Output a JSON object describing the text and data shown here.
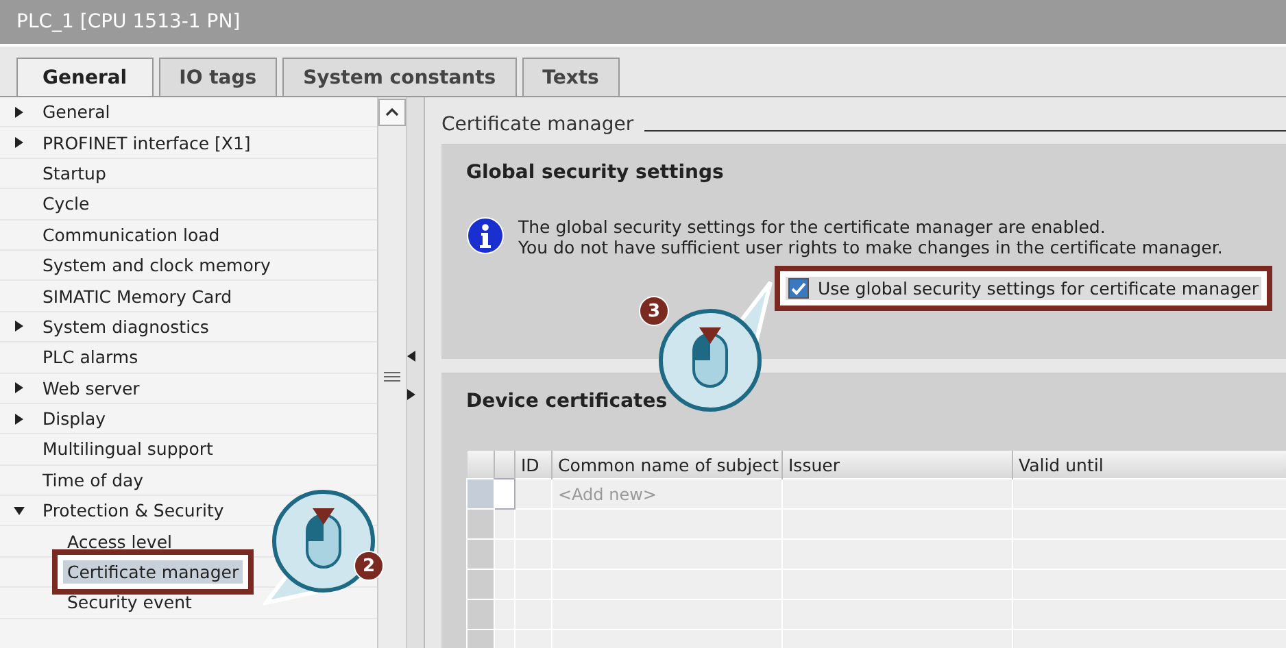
{
  "window": {
    "title": "PLC_1 [CPU 1513-1 PN]"
  },
  "tabs": [
    {
      "label": "General",
      "selected": true
    },
    {
      "label": "IO tags",
      "selected": false
    },
    {
      "label": "System constants",
      "selected": false
    },
    {
      "label": "Texts",
      "selected": false
    }
  ],
  "tree": [
    {
      "label": "General",
      "kind": "group",
      "expanded": false,
      "selected": false
    },
    {
      "label": "PROFINET interface [X1]",
      "kind": "group",
      "expanded": false,
      "selected": false
    },
    {
      "label": "Startup",
      "kind": "page",
      "selected": false
    },
    {
      "label": "Cycle",
      "kind": "page",
      "selected": false
    },
    {
      "label": "Communication load",
      "kind": "page",
      "selected": false
    },
    {
      "label": "System and clock memory",
      "kind": "page",
      "selected": false
    },
    {
      "label": "SIMATIC Memory Card",
      "kind": "page",
      "selected": false
    },
    {
      "label": "System diagnostics",
      "kind": "group",
      "expanded": false,
      "selected": false
    },
    {
      "label": "PLC alarms",
      "kind": "page",
      "selected": false
    },
    {
      "label": "Web server",
      "kind": "group",
      "expanded": false,
      "selected": false
    },
    {
      "label": "Display",
      "kind": "group",
      "expanded": false,
      "selected": false
    },
    {
      "label": "Multilingual support",
      "kind": "page",
      "selected": false
    },
    {
      "label": "Time of day",
      "kind": "page",
      "selected": false
    },
    {
      "label": "Protection & Security",
      "kind": "group",
      "expanded": true,
      "selected": false,
      "children": [
        {
          "label": "Access level",
          "kind": "page",
          "selected": false
        },
        {
          "label": "Certificate manager",
          "kind": "page",
          "selected": true,
          "highlighted": true
        },
        {
          "label": "Security event",
          "kind": "page",
          "selected": false
        }
      ]
    }
  ],
  "section_title": "Certificate manager",
  "global_security": {
    "title": "Global security settings",
    "info": [
      "The global security settings for the certificate manager are enabled.",
      "You do not have sufficient user rights to make changes in the certificate manager."
    ],
    "checkbox": {
      "label": "Use global security settings for certificate manager",
      "checked": true,
      "highlighted": true
    }
  },
  "device_certificates": {
    "title": "Device certificates",
    "table": {
      "columns": [
        "ID",
        "Common name of subject",
        "Issuer",
        "Valid until"
      ],
      "add_row_placeholder": "<Add new>"
    }
  },
  "callouts": [
    {
      "number": "2"
    },
    {
      "number": "3"
    }
  ]
}
